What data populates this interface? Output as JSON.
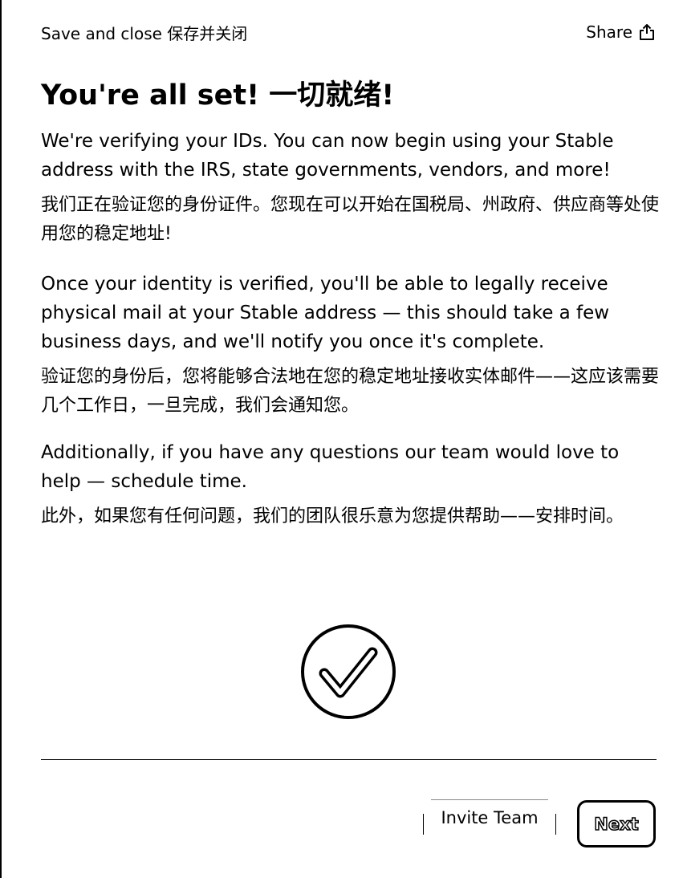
{
  "header": {
    "save_close_label": "Save and close 保存并关闭",
    "share_label": "Share"
  },
  "main": {
    "title": "You're all set! 一切就绪!",
    "paragraphs": [
      {
        "en": "We're verifying your IDs. You can now begin using your Stable address with the IRS, state governments, vendors, and more!",
        "zh": "我们正在验证您的身份证件。您现在可以开始在国税局、州政府、供应商等处使用您的稳定地址!"
      },
      {
        "en": "Once your identity is verified, you'll be able to legally receive physical mail at your Stable address — this should take a few business days, and we'll notify you once it's complete.",
        "zh": "验证您的身份后，您将能够合法地在您的稳定地址接收实体邮件——这应该需要几个工作日，一旦完成，我们会通知您。"
      },
      {
        "en": "Additionally, if you have any questions our team would love to help — schedule time.",
        "zh": "此外，如果您有任何问题，我们的团队很乐意为您提供帮助——安排时间。"
      }
    ]
  },
  "footer": {
    "invite_label": "Invite Team",
    "next_label": "Next"
  },
  "icons": {
    "share": "share-icon",
    "success": "checkmark-circle-icon"
  }
}
